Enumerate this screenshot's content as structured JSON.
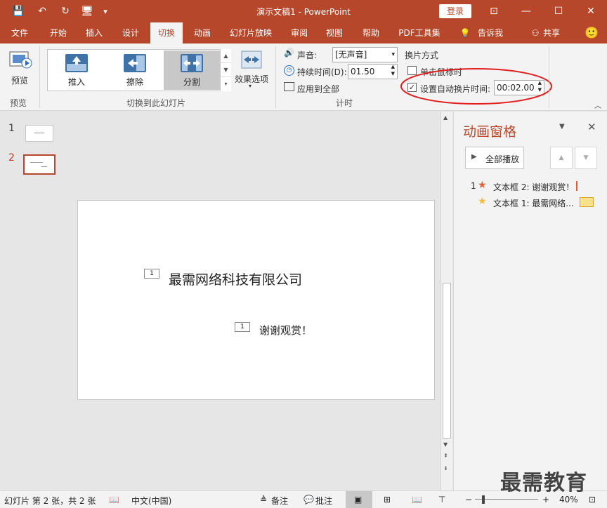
{
  "titlebar": {
    "doc_title": "演示文稿1 - PowerPoint",
    "login": "登录",
    "qa_save": "💾",
    "qa_undo": "↶",
    "qa_redo": "↻",
    "qa_present": "🖥",
    "qa_more": "▾",
    "win_ribbon_opt": "⊡",
    "win_min": "—",
    "win_max": "☐",
    "win_close": "✕"
  },
  "tabs": [
    "文件",
    "开始",
    "插入",
    "设计",
    "切换",
    "动画",
    "幻灯片放映",
    "审阅",
    "视图",
    "帮助",
    "PDF工具集",
    "告诉我",
    "共享"
  ],
  "tabs_active": "切换",
  "ribbon": {
    "preview_label": "预览",
    "preview_group": "预览",
    "gallery_items": [
      "推入",
      "擦除",
      "分割"
    ],
    "gallery_selected": "分割",
    "effect_options": "效果选项",
    "transition_group": "切换到此幻灯片",
    "sound_label": "声音:",
    "sound_value": "[无声音]",
    "duration_label": "持续时间(D):",
    "duration_value": "01.50",
    "apply_all": "应用到全部",
    "advance_title": "换片方式",
    "on_click_label": "单击鼠标时",
    "on_click_checked": false,
    "auto_label": "设置自动换片时间:",
    "auto_checked": true,
    "auto_value": "00:02.00",
    "timing_group": "计时"
  },
  "thumbs": {
    "slide1_num": "1",
    "slide2_num": "2"
  },
  "slide": {
    "text1": "最需网络科技有限公司",
    "text2": "谢谢观赏！",
    "tag1": "1",
    "tag2": "1"
  },
  "anim_pane": {
    "title": "动画窗格",
    "play_all": "全部播放",
    "items": [
      {
        "num": "1",
        "text": "文本框 2: 谢谢观赏！"
      },
      {
        "num": "",
        "text": "文本框 1: 最需网络..."
      }
    ],
    "accent": "#b7472a",
    "star_red": "#e25c34",
    "star_yellow": "#f4b942"
  },
  "statusbar": {
    "slide_info": "幻灯片 第 2 张，共 2 张",
    "language": "中文(中国)",
    "notes": "备注",
    "comments": "批注",
    "zoom": "40%"
  },
  "watermark": "最需教育"
}
